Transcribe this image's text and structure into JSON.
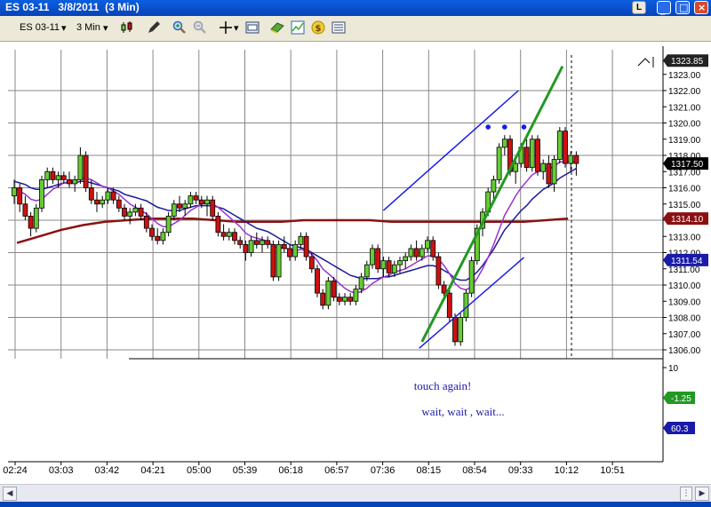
{
  "window": {
    "title": "ES 03-11   3/8/2011  (3 Min)",
    "layout_button": "L"
  },
  "toolbar": {
    "instrument": "ES 03-11",
    "interval": "3 Min"
  },
  "icons": [
    "candlestick-icon",
    "pencil-icon",
    "zoom-in-icon",
    "zoom-out-icon",
    "crosshair-icon",
    "properties-icon",
    "strategy-icon",
    "chart-trader-icon",
    "dollar-icon",
    "data-box-icon"
  ],
  "colors": {
    "bull": "#66cc33",
    "bear": "#cc1111",
    "ma_blue": "#1a1a9a",
    "ma_purple": "#9a33cc",
    "ma_red": "#8b1111",
    "channel": "#1a1aee",
    "trendline": "#229922",
    "dots": "#1a1aee"
  },
  "chart_data": {
    "type": "candlestick",
    "price_ticks": [
      "1306.00",
      "1307.00",
      "1308.00",
      "1309.00",
      "1310.00",
      "1311.00",
      "1312.00",
      "1313.00",
      "1314.00",
      "1315.00",
      "1316.00",
      "1317.00",
      "1318.00",
      "1319.00",
      "1320.00",
      "1321.00",
      "1322.00",
      "1323.00"
    ],
    "time_ticks": [
      "02:24",
      "03:03",
      "03:42",
      "04:21",
      "05:00",
      "05:39",
      "06:18",
      "06:57",
      "07:36",
      "08:15",
      "08:54",
      "09:33",
      "10:12",
      "10:51"
    ],
    "price_labels": [
      {
        "text": "1323.85",
        "value": 1323.85,
        "style": "dark"
      },
      {
        "text": "1317.50",
        "value": 1317.5,
        "style": "black"
      },
      {
        "text": "1314.10",
        "value": 1314.1,
        "style": "red"
      },
      {
        "text": "1311.54",
        "value": 1311.54,
        "style": "blue"
      }
    ],
    "indicator_panel": {
      "tick": "10",
      "labels": [
        {
          "text": "-1.25",
          "style": "green"
        },
        {
          "text": "60.3",
          "style": "blue"
        }
      ]
    },
    "annotations": [
      "touch again!",
      "wait, wait , wait..."
    ],
    "ohlc": [
      [
        1315.5,
        1316.5,
        1315.0,
        1316.0
      ],
      [
        1316.0,
        1316.25,
        1314.5,
        1315.0
      ],
      [
        1315.0,
        1315.5,
        1314.0,
        1314.25
      ],
      [
        1314.25,
        1314.5,
        1313.0,
        1313.5
      ],
      [
        1313.5,
        1315.0,
        1313.25,
        1314.75
      ],
      [
        1314.75,
        1316.75,
        1314.5,
        1316.5
      ],
      [
        1316.5,
        1317.25,
        1316.0,
        1317.0
      ],
      [
        1317.0,
        1317.25,
        1316.25,
        1316.5
      ],
      [
        1316.5,
        1317.0,
        1316.0,
        1316.75
      ],
      [
        1316.75,
        1317.0,
        1316.25,
        1316.5
      ],
      [
        1316.5,
        1317.0,
        1316.0,
        1316.25
      ],
      [
        1316.25,
        1316.75,
        1315.75,
        1316.5
      ],
      [
        1316.5,
        1318.5,
        1316.25,
        1318.0
      ],
      [
        1318.0,
        1318.25,
        1315.75,
        1316.0
      ],
      [
        1316.0,
        1316.5,
        1315.0,
        1315.25
      ],
      [
        1315.25,
        1315.75,
        1314.5,
        1315.0
      ],
      [
        1315.0,
        1315.5,
        1314.75,
        1315.25
      ],
      [
        1315.25,
        1316.0,
        1315.0,
        1315.75
      ],
      [
        1315.75,
        1316.0,
        1315.0,
        1315.25
      ],
      [
        1315.25,
        1315.5,
        1314.5,
        1314.75
      ],
      [
        1314.75,
        1315.0,
        1314.0,
        1314.25
      ],
      [
        1314.25,
        1314.75,
        1313.75,
        1314.5
      ],
      [
        1314.5,
        1315.0,
        1314.25,
        1314.75
      ],
      [
        1314.75,
        1315.0,
        1314.0,
        1314.25
      ],
      [
        1314.25,
        1314.5,
        1313.25,
        1313.5
      ],
      [
        1313.5,
        1313.75,
        1312.75,
        1313.0
      ],
      [
        1313.0,
        1313.5,
        1312.5,
        1312.75
      ],
      [
        1312.75,
        1313.5,
        1312.5,
        1313.25
      ],
      [
        1313.25,
        1314.5,
        1313.0,
        1314.25
      ],
      [
        1314.25,
        1315.25,
        1314.0,
        1315.0
      ],
      [
        1315.0,
        1315.5,
        1314.5,
        1314.75
      ],
      [
        1314.75,
        1315.25,
        1314.25,
        1315.0
      ],
      [
        1315.0,
        1315.75,
        1314.75,
        1315.5
      ],
      [
        1315.5,
        1315.75,
        1315.0,
        1315.25
      ],
      [
        1315.25,
        1315.5,
        1314.75,
        1315.0
      ],
      [
        1315.0,
        1315.5,
        1314.25,
        1315.25
      ],
      [
        1315.25,
        1315.5,
        1314.0,
        1314.25
      ],
      [
        1314.25,
        1314.5,
        1313.0,
        1313.25
      ],
      [
        1313.25,
        1313.75,
        1312.75,
        1313.0
      ],
      [
        1313.0,
        1313.5,
        1312.75,
        1313.25
      ],
      [
        1313.25,
        1313.5,
        1312.5,
        1312.75
      ],
      [
        1312.75,
        1313.0,
        1312.25,
        1312.5
      ],
      [
        1312.5,
        1312.75,
        1311.5,
        1312.0
      ],
      [
        1312.0,
        1313.0,
        1311.75,
        1312.75
      ],
      [
        1312.75,
        1313.25,
        1312.25,
        1312.5
      ],
      [
        1312.5,
        1313.0,
        1312.0,
        1312.75
      ],
      [
        1312.75,
        1313.0,
        1312.25,
        1312.5
      ],
      [
        1312.5,
        1312.75,
        1310.25,
        1310.5
      ],
      [
        1310.5,
        1312.75,
        1310.25,
        1312.5
      ],
      [
        1312.5,
        1313.0,
        1312.0,
        1312.25
      ],
      [
        1312.25,
        1312.5,
        1311.5,
        1311.75
      ],
      [
        1311.75,
        1312.75,
        1311.5,
        1312.5
      ],
      [
        1312.5,
        1313.25,
        1312.25,
        1313.0
      ],
      [
        1313.0,
        1313.25,
        1311.5,
        1311.75
      ],
      [
        1311.75,
        1312.0,
        1310.75,
        1311.0
      ],
      [
        1311.0,
        1311.25,
        1309.25,
        1309.5
      ],
      [
        1309.5,
        1309.75,
        1308.5,
        1308.75
      ],
      [
        1308.75,
        1310.5,
        1308.5,
        1310.25
      ],
      [
        1310.25,
        1310.5,
        1309.0,
        1309.25
      ],
      [
        1309.25,
        1309.5,
        1308.75,
        1309.0
      ],
      [
        1309.0,
        1309.5,
        1308.75,
        1309.25
      ],
      [
        1309.25,
        1309.5,
        1308.75,
        1309.0
      ],
      [
        1309.0,
        1310.0,
        1308.75,
        1309.75
      ],
      [
        1309.75,
        1310.75,
        1309.5,
        1310.5
      ],
      [
        1310.5,
        1311.5,
        1310.25,
        1311.25
      ],
      [
        1311.25,
        1312.5,
        1311.0,
        1312.25
      ],
      [
        1312.25,
        1312.5,
        1310.75,
        1311.0
      ],
      [
        1311.0,
        1311.75,
        1310.5,
        1311.5
      ],
      [
        1311.5,
        1311.75,
        1310.5,
        1310.75
      ],
      [
        1310.75,
        1311.5,
        1310.5,
        1311.25
      ],
      [
        1311.25,
        1311.75,
        1310.75,
        1311.5
      ],
      [
        1311.5,
        1312.0,
        1311.0,
        1311.75
      ],
      [
        1311.75,
        1312.5,
        1311.5,
        1312.25
      ],
      [
        1312.25,
        1312.75,
        1311.5,
        1311.75
      ],
      [
        1311.75,
        1312.5,
        1311.5,
        1312.25
      ],
      [
        1312.25,
        1313.0,
        1312.0,
        1312.75
      ],
      [
        1312.75,
        1313.0,
        1311.5,
        1311.75
      ],
      [
        1311.75,
        1312.0,
        1309.75,
        1310.0
      ],
      [
        1310.0,
        1310.25,
        1309.25,
        1309.5
      ],
      [
        1309.5,
        1309.75,
        1307.75,
        1308.0
      ],
      [
        1308.0,
        1308.25,
        1306.25,
        1306.5
      ],
      [
        1306.5,
        1308.25,
        1306.25,
        1308.0
      ],
      [
        1308.0,
        1309.75,
        1307.75,
        1309.5
      ],
      [
        1309.5,
        1311.75,
        1309.25,
        1311.5
      ],
      [
        1311.5,
        1313.75,
        1311.25,
        1313.5
      ],
      [
        1313.5,
        1314.75,
        1313.0,
        1314.5
      ],
      [
        1314.5,
        1316.0,
        1314.25,
        1315.75
      ],
      [
        1315.75,
        1316.75,
        1315.25,
        1316.5
      ],
      [
        1316.5,
        1318.75,
        1316.25,
        1318.5
      ],
      [
        1318.5,
        1319.25,
        1318.0,
        1319.0
      ],
      [
        1319.0,
        1319.25,
        1316.75,
        1317.0
      ],
      [
        1317.0,
        1317.75,
        1316.25,
        1317.5
      ],
      [
        1317.5,
        1318.75,
        1317.25,
        1318.5
      ],
      [
        1318.5,
        1319.0,
        1317.0,
        1317.25
      ],
      [
        1317.25,
        1319.25,
        1317.0,
        1319.0
      ],
      [
        1319.0,
        1319.25,
        1316.75,
        1317.0
      ],
      [
        1317.0,
        1317.75,
        1316.5,
        1317.5
      ],
      [
        1317.5,
        1318.0,
        1316.0,
        1316.25
      ],
      [
        1316.25,
        1318.0,
        1315.75,
        1317.75
      ],
      [
        1317.75,
        1319.75,
        1317.5,
        1319.5
      ],
      [
        1319.5,
        1319.75,
        1317.25,
        1317.5
      ],
      [
        1317.5,
        1318.25,
        1317.0,
        1318.0
      ],
      [
        1318.0,
        1318.25,
        1316.75,
        1317.5
      ]
    ],
    "moving_averages": [
      {
        "name": "blue",
        "values": [
          1316.4,
          1316.3,
          1316.2,
          1316.0,
          1315.9,
          1315.9,
          1316.0,
          1316.1,
          1316.2,
          1316.3,
          1316.3,
          1316.3,
          1316.4,
          1316.4,
          1316.3,
          1316.2,
          1316.1,
          1316.0,
          1315.9,
          1315.8,
          1315.6,
          1315.5,
          1315.4,
          1315.3,
          1315.2,
          1315.0,
          1314.8,
          1314.7,
          1314.6,
          1314.6,
          1314.6,
          1314.7,
          1314.8,
          1314.9,
          1314.9,
          1314.9,
          1314.9,
          1314.8,
          1314.7,
          1314.5,
          1314.3,
          1314.1,
          1313.9,
          1313.7,
          1313.5,
          1313.4,
          1313.3,
          1313.1,
          1312.9,
          1312.7,
          1312.5,
          1312.4,
          1312.3,
          1312.2,
          1312.0,
          1311.8,
          1311.6,
          1311.4,
          1311.2,
          1311.0,
          1310.8,
          1310.6,
          1310.5,
          1310.4,
          1310.4,
          1310.4,
          1310.4,
          1310.5,
          1310.5,
          1310.6,
          1310.7,
          1310.8,
          1310.9,
          1311.0,
          1311.1,
          1311.2,
          1311.2,
          1311.1,
          1310.9,
          1310.7,
          1310.4,
          1310.3,
          1310.3,
          1310.5,
          1310.8,
          1311.2,
          1311.7,
          1312.2,
          1312.8,
          1313.4,
          1313.8,
          1314.2,
          1314.6,
          1314.9,
          1315.3,
          1315.6,
          1315.9,
          1316.1,
          1316.3,
          1316.6,
          1316.8,
          1317.0,
          1317.2
        ]
      },
      {
        "name": "purple",
        "values": [
          1316.0,
          1315.8,
          1315.6,
          1315.3,
          1315.2,
          1315.3,
          1315.6,
          1315.9,
          1316.1,
          1316.3,
          1316.4,
          1316.4,
          1316.6,
          1316.6,
          1316.5,
          1316.3,
          1316.1,
          1316.0,
          1315.8,
          1315.6,
          1315.3,
          1315.0,
          1314.8,
          1314.6,
          1314.4,
          1314.1,
          1313.8,
          1313.6,
          1313.6,
          1313.8,
          1314.0,
          1314.3,
          1314.6,
          1314.8,
          1315.0,
          1315.1,
          1315.0,
          1314.8,
          1314.5,
          1314.2,
          1313.9,
          1313.6,
          1313.2,
          1313.0,
          1312.9,
          1312.8,
          1312.7,
          1312.4,
          1312.3,
          1312.3,
          1312.2,
          1312.1,
          1312.2,
          1312.1,
          1311.9,
          1311.5,
          1311.0,
          1310.7,
          1310.4,
          1310.1,
          1309.8,
          1309.6,
          1309.5,
          1309.6,
          1309.8,
          1310.1,
          1310.3,
          1310.5,
          1310.6,
          1310.8,
          1310.9,
          1311.0,
          1311.2,
          1311.4,
          1311.6,
          1311.8,
          1311.8,
          1311.6,
          1311.2,
          1310.7,
          1310.1,
          1309.8,
          1309.7,
          1309.9,
          1310.4,
          1311.0,
          1311.7,
          1312.5,
          1313.4,
          1314.3,
          1314.9,
          1315.5,
          1316.0,
          1316.4,
          1316.8,
          1317.0,
          1317.2,
          1317.2,
          1317.3,
          1317.6,
          1317.6,
          1317.6,
          1317.6
        ]
      },
      {
        "name": "red",
        "values": [
          1312.6,
          1313.0,
          1313.4,
          1313.7,
          1313.9,
          1314.0,
          1314.1,
          1314.1,
          1314.1,
          1314.0,
          1313.9,
          1313.9,
          1313.9,
          1314.0,
          1314.0,
          1314.0,
          1314.0,
          1313.9,
          1313.9,
          1313.9,
          1313.9,
          1313.9,
          1313.9,
          1313.9,
          1314.0,
          1314.1
        ]
      }
    ],
    "channel_lines": [
      {
        "from": [
          67.0,
          1314.6
        ],
        "to": [
          91.5,
          1322.0
        ]
      },
      {
        "from": [
          73.5,
          1306.1
        ],
        "to": [
          92.5,
          1311.7
        ]
      }
    ],
    "trendline": {
      "from": [
        74.0,
        1306.5
      ],
      "to": [
        99.5,
        1323.5
      ]
    },
    "dots": [
      [
        86,
        1319.75
      ],
      [
        89,
        1319.75
      ],
      [
        92.5,
        1319.75
      ]
    ],
    "ylim": [
      1305.6,
      1324.4
    ]
  }
}
